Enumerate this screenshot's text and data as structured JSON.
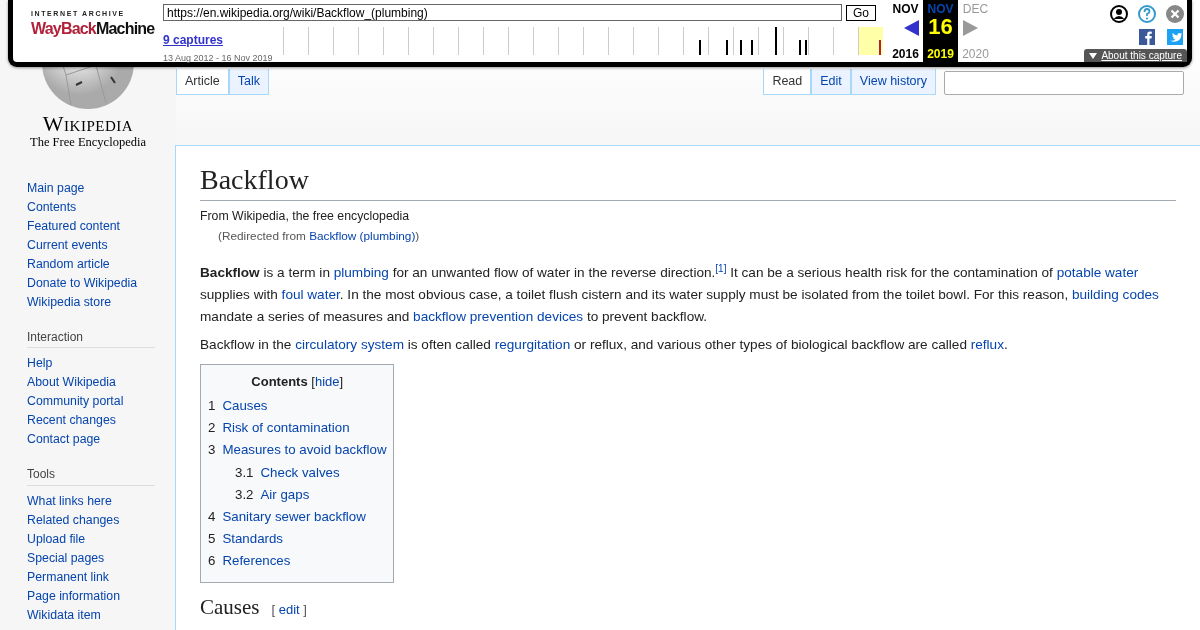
{
  "wayback": {
    "logo_top": "INTERNET ARCHIVE",
    "logo_word_1": "WayBack",
    "logo_word_2": "Machine",
    "url": "https://en.wikipedia.org/wiki/Backflow_(plumbing)",
    "go": "Go",
    "captures": "9 captures",
    "range": "13 Aug 2012 - 16 Nov 2019",
    "calendar": [
      {
        "kind": "prev",
        "month": "NOV",
        "year": "2016",
        "selected": false
      },
      {
        "kind": "current",
        "month": "NOV",
        "day": "16",
        "year": "2019",
        "selected": true
      },
      {
        "kind": "next",
        "month": "DEC",
        "year": "2020",
        "selected": false
      }
    ],
    "about": "About this capture"
  },
  "logo": {
    "wordmark": "Wikipedia",
    "tagline": "The Free Encyclopedia"
  },
  "tabs_left": [
    {
      "label": "Article",
      "selected": true
    },
    {
      "label": "Talk",
      "selected": false
    }
  ],
  "tabs_right": [
    {
      "label": "Read",
      "selected": true
    },
    {
      "label": "Edit",
      "selected": false
    },
    {
      "label": "View history",
      "selected": false
    }
  ],
  "sidebar": [
    {
      "items": [
        "Main page",
        "Contents",
        "Featured content",
        "Current events",
        "Random article",
        "Donate to Wikipedia",
        "Wikipedia store"
      ]
    },
    {
      "heading": "Interaction",
      "items": [
        "Help",
        "About Wikipedia",
        "Community portal",
        "Recent changes",
        "Contact page"
      ]
    },
    {
      "heading": "Tools",
      "items": [
        "What links here",
        "Related changes",
        "Upload file",
        "Special pages",
        "Permanent link",
        "Page information",
        "Wikidata item"
      ]
    }
  ],
  "article": {
    "title": "Backflow",
    "subtitle": "From Wikipedia, the free encyclopedia",
    "redirect_prefix": "(Redirected from ",
    "redirect_link": "Backflow (plumbing)",
    "redirect_suffix": ")",
    "paragraphs": [
      [
        {
          "kind": "bold",
          "text": "Backflow"
        },
        {
          "kind": "plain",
          "text": " is a term in "
        },
        {
          "kind": "link",
          "text": "plumbing"
        },
        {
          "kind": "plain",
          "text": " for an unwanted flow of water in the reverse direction."
        },
        {
          "kind": "ref",
          "text": "[1]"
        },
        {
          "kind": "plain",
          "text": " It can be a serious health risk for the contamination of "
        },
        {
          "kind": "link",
          "text": "potable water"
        },
        {
          "kind": "plain",
          "text": " supplies with "
        },
        {
          "kind": "link",
          "text": "foul water"
        },
        {
          "kind": "plain",
          "text": ". In the most obvious case, a toilet flush cistern and its water supply must be isolated from the toilet bowl. For this reason, "
        },
        {
          "kind": "link",
          "text": "building codes"
        },
        {
          "kind": "plain",
          "text": " mandate a series of measures and "
        },
        {
          "kind": "link",
          "text": "backflow prevention devices"
        },
        {
          "kind": "plain",
          "text": " to prevent backflow."
        }
      ],
      [
        {
          "kind": "plain",
          "text": "Backflow in the "
        },
        {
          "kind": "link",
          "text": "circulatory system"
        },
        {
          "kind": "plain",
          "text": " is often called "
        },
        {
          "kind": "link",
          "text": "regurgitation"
        },
        {
          "kind": "plain",
          "text": " or reflux, and various other types of biological backflow are called "
        },
        {
          "kind": "link",
          "text": "reflux"
        },
        {
          "kind": "plain",
          "text": "."
        }
      ]
    ],
    "toc": {
      "title": "Contents",
      "toggle_open": "[",
      "toggle": "hide",
      "toggle_close": "]",
      "items": [
        {
          "number": "1",
          "label": "Causes"
        },
        {
          "number": "2",
          "label": "Risk of contamination"
        },
        {
          "number": "3",
          "label": "Measures to avoid backflow",
          "children": [
            {
              "number": "3.1",
              "label": "Check valves"
            },
            {
              "number": "3.2",
              "label": "Air gaps"
            }
          ]
        },
        {
          "number": "4",
          "label": "Sanitary sewer backflow"
        },
        {
          "number": "5",
          "label": "Standards"
        },
        {
          "number": "6",
          "label": "References"
        }
      ]
    },
    "section": {
      "title": "Causes",
      "edit_open": "[",
      "edit": "edit",
      "edit_close": "]"
    }
  }
}
